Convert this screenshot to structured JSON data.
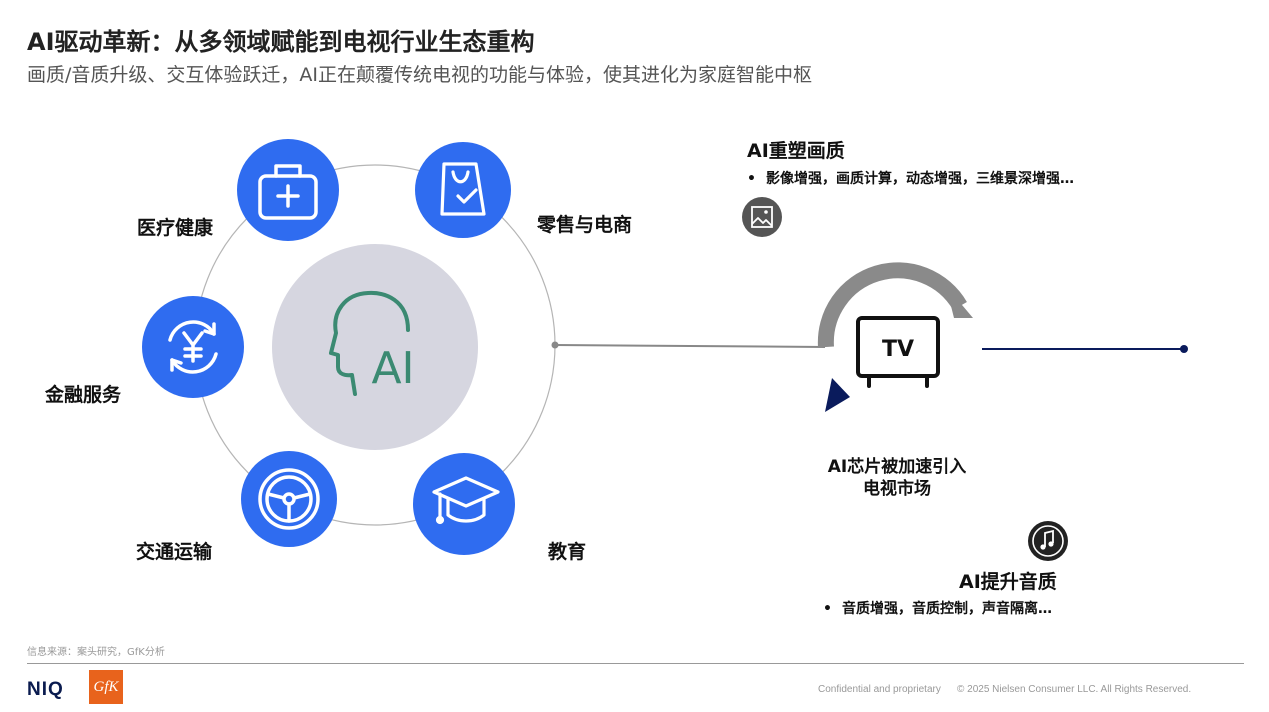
{
  "header": {
    "title": "AI驱动革新：从多领域赋能到电视行业生态重构",
    "subtitle": "画质/音质升级、交互体验跃迁，AI正在颠覆传统电视的功能与体验，使其进化为家庭智能中枢"
  },
  "hub": {
    "center_text": "AI",
    "domains": [
      {
        "label": "医疗健康",
        "icon": "first-aid-kit-icon"
      },
      {
        "label": "零售与电商",
        "icon": "shopping-bag-check-icon"
      },
      {
        "label": "金融服务",
        "icon": "currency-exchange-yen-icon"
      },
      {
        "label": "交通运输",
        "icon": "steering-wheel-icon"
      },
      {
        "label": "教育",
        "icon": "graduation-cap-icon"
      }
    ]
  },
  "tv": {
    "icon_text": "TV",
    "caption_line1": "AI芯片被加速引入",
    "caption_line2": "电视市场"
  },
  "features": {
    "picture": {
      "title": "AI重塑画质",
      "bullet": "影像增强，画质计算，动态增强，三维景深增强…",
      "icon": "image-icon"
    },
    "sound": {
      "title": "AI提升音质",
      "bullet": "音质增强，音质控制，声音隔离…",
      "icon": "music-note-icon"
    }
  },
  "footer": {
    "source": "信息来源：案头研究，GfK分析",
    "niq_logo": "NIQ",
    "gfk_logo": "GfK",
    "confidential": "Confidential and proprietary",
    "copyright": "© 2025 Nielsen Consumer LLC. All Rights Reserved."
  },
  "colors": {
    "domain_blue": "#2f6cf0",
    "hub_gray": "#d6d6e0",
    "ai_green": "#3b8a72",
    "arrow_gray": "#8a8a8a",
    "arrow_dark": "#222222",
    "arrow_navy": "#0a1b5c"
  }
}
